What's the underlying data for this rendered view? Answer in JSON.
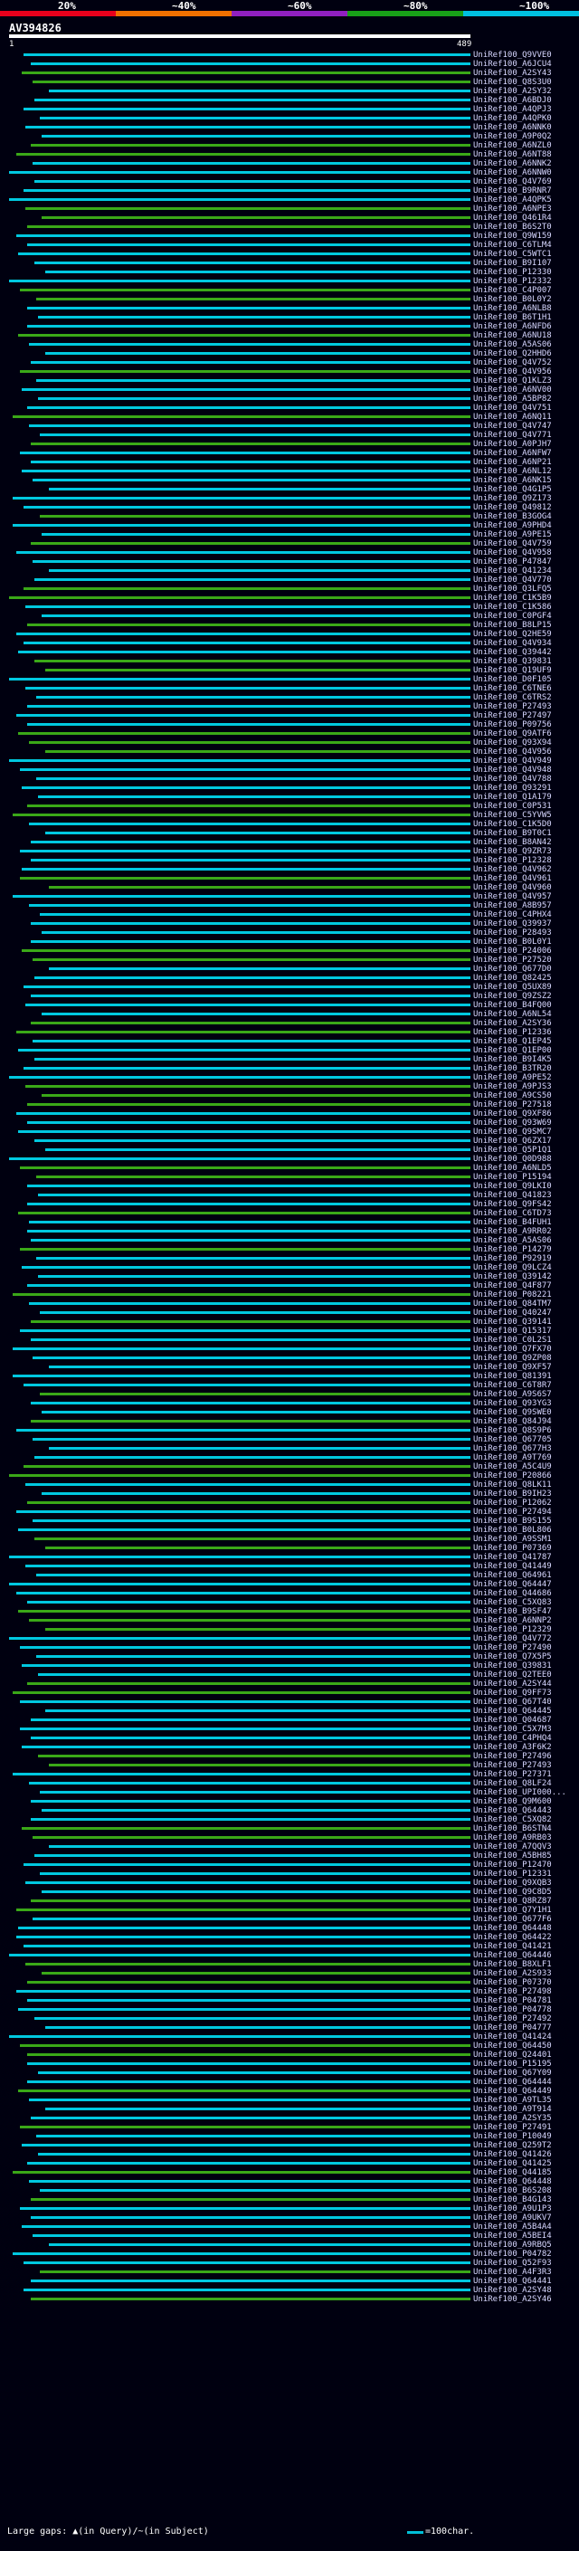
{
  "scale": {
    "labels": [
      "20%",
      "~40%",
      "~60%",
      "~80%",
      "~100%"
    ],
    "colors": [
      "#e8001c",
      "#f07000",
      "#9020c0",
      "#18a018",
      "#00c0e0"
    ]
  },
  "query": {
    "title": "AV394826",
    "start": "1",
    "end": "489"
  },
  "colors": {
    "cyan": "#00c8e0",
    "green": "#3aa818",
    "background": "#000010"
  },
  "hits": [
    "UniRef100_Q9VVE0",
    "UniRef100_A6JCU4",
    "UniRef100_A2SY43",
    "UniRef100_Q8S3U0",
    "UniRef100_A2SY32",
    "UniRef100_A6BDJ0",
    "UniRef100_A4QPJ3",
    "UniRef100_A4QPK0",
    "UniRef100_A6NNK0",
    "UniRef100_A9P0Q2",
    "UniRef100_A6NZL0",
    "UniRef100_A6NT88",
    "UniRef100_A6NNK2",
    "UniRef100_A6NNW0",
    "UniRef100_Q4V769",
    "UniRef100_B9RNR7",
    "UniRef100_A4QPK5",
    "UniRef100_A6NPE3",
    "UniRef100_Q461R4",
    "UniRef100_B6S2T0",
    "UniRef100_Q9W159",
    "UniRef100_C6TLM4",
    "UniRef100_C5WTC1",
    "UniRef100_B9I107",
    "UniRef100_P12330",
    "UniRef100_P12332",
    "UniRef100_C4P007",
    "UniRef100_B0L0Y2",
    "UniRef100_A6NLB8",
    "UniRef100_B6T1H1",
    "UniRef100_A6NFD6",
    "UniRef100_A6NU18",
    "UniRef100_A5AS06",
    "UniRef100_Q2HHD6",
    "UniRef100_Q4V752",
    "UniRef100_Q4V956",
    "UniRef100_Q1KLZ3",
    "UniRef100_A6NV00",
    "UniRef100_A5BP82",
    "UniRef100_Q4V751",
    "UniRef100_A6NQ11",
    "UniRef100_Q4V747",
    "UniRef100_Q4V771",
    "UniRef100_A0PJH7",
    "UniRef100_A6NFW7",
    "UniRef100_A6NP21",
    "UniRef100_A6NL12",
    "UniRef100_A6NK15",
    "UniRef100_Q4G1P5",
    "UniRef100_Q9Z173",
    "UniRef100_Q49812",
    "UniRef100_B3GOG4",
    "UniRef100_A9PHD4",
    "UniRef100_A9PE15",
    "UniRef100_Q4V759",
    "UniRef100_Q4V958",
    "UniRef100_P47847",
    "UniRef100_Q41234",
    "UniRef100_Q4V770",
    "UniRef100_Q3LFQ5",
    "UniRef100_C1K5B9",
    "UniRef100_C1K586",
    "UniRef100_C0PGF4",
    "UniRef100_B8LP15",
    "UniRef100_Q2HE59",
    "UniRef100_Q4V934",
    "UniRef100_Q39442",
    "UniRef100_Q39831",
    "UniRef100_Q19UF9",
    "UniRef100_D0F105",
    "UniRef100_C6TNE6",
    "UniRef100_C6TRS2",
    "UniRef100_P27493",
    "UniRef100_P27497",
    "UniRef100_P09756",
    "UniRef100_Q9ATF6",
    "UniRef100_Q93X94",
    "UniRef100_Q4V956",
    "UniRef100_Q4V949",
    "UniRef100_Q4V948",
    "UniRef100_Q4V788",
    "UniRef100_Q93291",
    "UniRef100_Q1A179",
    "UniRef100_C0P531",
    "UniRef100_C5YVW5",
    "UniRef100_C1K5D0",
    "UniRef100_B9T0C1",
    "UniRef100_B8AN42",
    "UniRef100_Q9ZR73",
    "UniRef100_P12328",
    "UniRef100_Q4V962",
    "UniRef100_Q4V961",
    "UniRef100_Q4V960",
    "UniRef100_Q4V957",
    "UniRef100_A8B957",
    "UniRef100_C4PHX4",
    "UniRef100_Q39937",
    "UniRef100_P28493",
    "UniRef100_B0L0Y1",
    "UniRef100_P24006",
    "UniRef100_P27520",
    "UniRef100_Q677D0",
    "UniRef100_Q82425",
    "UniRef100_Q5UX89",
    "UniRef100_Q9ZSZ2",
    "UniRef100_B4FQ00",
    "UniRef100_A6NL54",
    "UniRef100_A2SY36",
    "UniRef100_P12336",
    "UniRef100_Q1EP45",
    "UniRef100_Q1EP00",
    "UniRef100_B9I4K5",
    "UniRef100_B3TR20",
    "UniRef100_A9PE52",
    "UniRef100_A9PJS3",
    "UniRef100_A9CS50",
    "UniRef100_P27518",
    "UniRef100_Q9XF86",
    "UniRef100_Q93W69",
    "UniRef100_Q9SMC7",
    "UniRef100_Q6ZX17",
    "UniRef100_Q5P1Q1",
    "UniRef100_Q0D988",
    "UniRef100_A6NLD5",
    "UniRef100_P15194",
    "UniRef100_Q9LKI0",
    "UniRef100_Q41823",
    "UniRef100_Q9FS42",
    "UniRef100_C6TD73",
    "UniRef100_B4FUH1",
    "UniRef100_A9RR02",
    "UniRef100_A5AS06",
    "UniRef100_P14279",
    "UniRef100_P92919",
    "UniRef100_Q9LCZ4",
    "UniRef100_Q39142",
    "UniRef100_Q4F877",
    "UniRef100_P08221",
    "UniRef100_Q84TM7",
    "UniRef100_Q40247",
    "UniRef100_Q39141",
    "UniRef100_Q15317",
    "UniRef100_C0L2S1",
    "UniRef100_Q7FX70",
    "UniRef100_Q9ZP08",
    "UniRef100_Q9XF57",
    "UniRef100_Q81391",
    "UniRef100_C6T8R7",
    "UniRef100_A9S6S7",
    "UniRef100_Q93YG3",
    "UniRef100_Q9SWE0",
    "UniRef100_Q84J94",
    "UniRef100_Q8S9P6",
    "UniRef100_Q67705",
    "UniRef100_Q677H3",
    "UniRef100_A9T769",
    "UniRef100_A5C4U9",
    "UniRef100_P20866",
    "UniRef100_Q8LK11",
    "UniRef100_B9IH23",
    "UniRef100_P12062",
    "UniRef100_P27494",
    "UniRef100_B9S155",
    "UniRef100_B0L806",
    "UniRef100_A9SSM1",
    "UniRef100_P07369",
    "UniRef100_Q41787",
    "UniRef100_Q41449",
    "UniRef100_Q64961",
    "UniRef100_Q64447",
    "UniRef100_Q44686",
    "UniRef100_C5XQ83",
    "UniRef100_B9SF47",
    "UniRef100_A6NNP2",
    "UniRef100_P12329",
    "UniRef100_Q4V772",
    "UniRef100_P27490",
    "UniRef100_Q7X5P5",
    "UniRef100_Q39831",
    "UniRef100_Q2TEE0",
    "UniRef100_A2SY44",
    "UniRef100_Q9FF73",
    "UniRef100_Q67T40",
    "UniRef100_Q64445",
    "UniRef100_Q04687",
    "UniRef100_C5X7M3",
    "UniRef100_C4PHQ4",
    "UniRef100_A3F6K2",
    "UniRef100_P27496",
    "UniRef100_P27493",
    "UniRef100_P27371",
    "UniRef100_Q8LF24",
    "UniRef100_UPI000...",
    "UniRef100_Q9M600",
    "UniRef100_Q64443",
    "UniRef100_C5XQ82",
    "UniRef100_B6STN4",
    "UniRef100_A9RB03",
    "UniRef100_A7QQV3",
    "UniRef100_A5BH85",
    "UniRef100_P12470",
    "UniRef100_P12331",
    "UniRef100_Q9XQB3",
    "UniRef100_Q9C8D5",
    "UniRef100_Q8RZ87",
    "UniRef100_Q7Y1H1",
    "UniRef100_Q677F6",
    "UniRef100_Q64448",
    "UniRef100_Q64422",
    "UniRef100_Q41421",
    "UniRef100_Q64446",
    "UniRef100_B8XLF1",
    "UniRef100_A2S933",
    "UniRef100_P07370",
    "UniRef100_P27498",
    "UniRef100_P04781",
    "UniRef100_P04778",
    "UniRef100_P27492",
    "UniRef100_P04777",
    "UniRef100_Q41424",
    "UniRef100_Q64450",
    "UniRef100_Q24401",
    "UniRef100_P15195",
    "UniRef100_Q67Y09",
    "UniRef100_Q64444",
    "UniRef100_Q64449",
    "UniRef100_A9TL35",
    "UniRef100_A9T914",
    "UniRef100_A2SY35",
    "UniRef100_P27491",
    "UniRef100_P10049",
    "UniRef100_Q259T2",
    "UniRef100_Q41426",
    "UniRef100_Q41425",
    "UniRef100_Q44185",
    "UniRef100_Q64448",
    "UniRef100_B6S208",
    "UniRef100_B4G143",
    "UniRef100_A9U1P3",
    "UniRef100_A9UKV7",
    "UniRef100_A5B4A4",
    "UniRef100_A5BEI4",
    "UniRef100_A9RBQ5",
    "UniRef100_P04782",
    "UniRef100_Q52F93",
    "UniRef100_A4F3R3",
    "UniRef100_Q64441",
    "UniRef100_A2SY48",
    "UniRef100_A2SY46"
  ],
  "footer": {
    "legend_text": "Large gaps: ▲(in Query)/~(in Subject)",
    "scale_text": "=100char."
  }
}
